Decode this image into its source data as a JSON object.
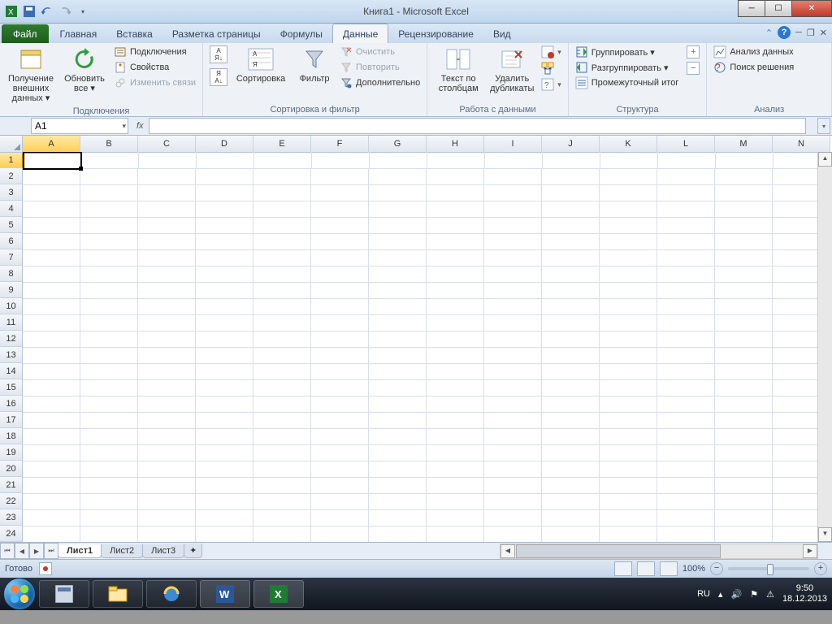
{
  "title": "Книга1  -  Microsoft Excel",
  "qat": {
    "save": "save-icon",
    "undo": "undo-icon",
    "redo": "redo-icon"
  },
  "tabs": {
    "file": "Файл",
    "items": [
      "Главная",
      "Вставка",
      "Разметка страницы",
      "Формулы",
      "Данные",
      "Рецензирование",
      "Вид"
    ],
    "active": "Данные"
  },
  "ribbon": {
    "groups": [
      {
        "label": "Подключения",
        "big": [
          {
            "id": "get-external",
            "line1": "Получение",
            "line2": "внешних данных ▾"
          },
          {
            "id": "refresh-all",
            "line1": "Обновить",
            "line2": "все ▾"
          }
        ],
        "small": [
          {
            "id": "connections",
            "label": "Подключения"
          },
          {
            "id": "properties",
            "label": "Свойства"
          },
          {
            "id": "edit-links",
            "label": "Изменить связи",
            "disabled": true
          }
        ]
      },
      {
        "label": "Сортировка и фильтр",
        "big": [
          {
            "id": "sort",
            "line1": "Сортировка",
            "line2": ""
          },
          {
            "id": "filter",
            "line1": "Фильтр",
            "line2": ""
          }
        ],
        "az": {
          "asc": "А↑Я",
          "desc": "Я↓А"
        },
        "small": [
          {
            "id": "clear",
            "label": "Очистить",
            "disabled": true
          },
          {
            "id": "reapply",
            "label": "Повторить",
            "disabled": true
          },
          {
            "id": "advanced",
            "label": "Дополнительно"
          }
        ]
      },
      {
        "label": "Работа с данными",
        "big": [
          {
            "id": "text-to-columns",
            "line1": "Текст по",
            "line2": "столбцам"
          },
          {
            "id": "remove-duplicates",
            "line1": "Удалить",
            "line2": "дубликаты"
          }
        ],
        "icons": [
          "data-validation",
          "consolidate",
          "whatif"
        ]
      },
      {
        "label": "Структура",
        "small": [
          {
            "id": "group",
            "label": "Группировать ▾"
          },
          {
            "id": "ungroup",
            "label": "Разгруппировать ▾"
          },
          {
            "id": "subtotal",
            "label": "Промежуточный итог"
          }
        ]
      },
      {
        "label": "Анализ",
        "small": [
          {
            "id": "data-analysis",
            "label": "Анализ данных"
          },
          {
            "id": "solver",
            "label": "Поиск решения"
          }
        ]
      }
    ]
  },
  "namebox": "A1",
  "fx": "",
  "columns": [
    "A",
    "B",
    "C",
    "D",
    "E",
    "F",
    "G",
    "H",
    "I",
    "J",
    "K",
    "L",
    "M",
    "N"
  ],
  "rows": [
    1,
    2,
    3,
    4,
    5,
    6,
    7,
    8,
    9,
    10,
    11,
    12,
    13,
    14,
    15,
    16,
    17,
    18,
    19,
    20,
    21,
    22,
    23,
    24
  ],
  "selected": {
    "col": "A",
    "row": 1
  },
  "sheets": [
    "Лист1",
    "Лист2",
    "Лист3"
  ],
  "active_sheet": "Лист1",
  "status": {
    "ready": "Готово",
    "zoom": "100%"
  },
  "tray": {
    "lang": "RU",
    "time": "9:50",
    "date": "18.12.2013"
  }
}
